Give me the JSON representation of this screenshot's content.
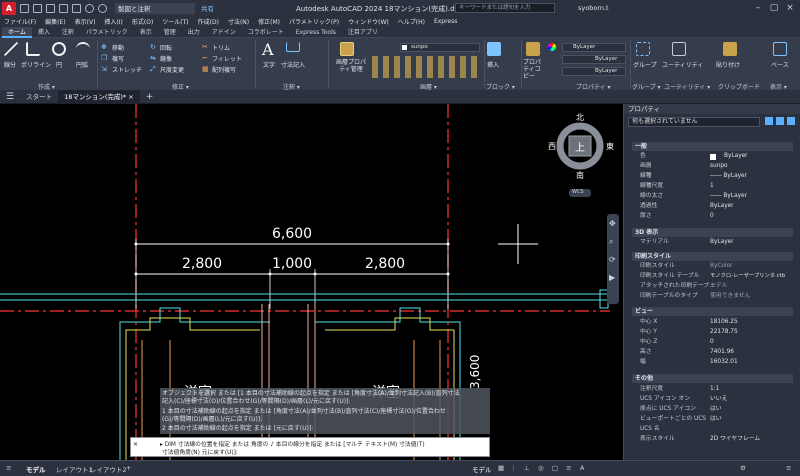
{
  "titlebar": {
    "app_letter": "A",
    "workspace": "製図と注釈",
    "share": "共有",
    "title": "Autodesk AutoCAD 2024   18マンション(完成).dwg",
    "search_placeholder": "キーワードまたは語句を入力",
    "user": "syoborn.t"
  },
  "menu": [
    "ファイル(F)",
    "編集(E)",
    "表示(V)",
    "挿入(I)",
    "形式(O)",
    "ツール(T)",
    "作成(D)",
    "寸法(N)",
    "修正(M)",
    "パラメトリック(P)",
    "ウィンドウ(W)",
    "ヘルプ(H)",
    "Express"
  ],
  "ribbon_tabs": [
    "ホーム",
    "挿入",
    "注釈",
    "パラメトリック",
    "表示",
    "管理",
    "出力",
    "アドイン",
    "コラボレート",
    "Express Tools",
    "注目アプリ"
  ],
  "ribbon": {
    "draw": [
      "線分",
      "ポリライン",
      "円",
      "円弧"
    ],
    "modify": [
      "移動",
      "回転",
      "トリム",
      "複写",
      "鏡像",
      "フィレット",
      "ストレッチ",
      "尺度変更",
      "配列複写"
    ],
    "annotation": [
      "文字",
      "寸法記入"
    ],
    "layers": [
      "画層プロパティ管理"
    ],
    "layer_current": "sunpo",
    "block": [
      "挿入"
    ],
    "properties_btn": [
      "プロパティコピー"
    ],
    "bylayer": [
      "ByLayer",
      "ByLayer",
      "ByLayer"
    ],
    "groups": [
      "グループ"
    ],
    "utilities": [
      "ユーティリティ"
    ],
    "clipboard": [
      "貼り付け"
    ],
    "base": [
      "ベース"
    ],
    "group_labels": [
      "作成 ▾",
      "修正 ▾",
      "注釈 ▾",
      "画層 ▾",
      "ブロック ▾",
      "プロパティ ▾",
      "グループ ▾",
      "ユーティリティ ▾",
      "クリップボード",
      "表示 ▾"
    ]
  },
  "file_tabs": [
    "スタート",
    "18マンション(完成)*"
  ],
  "viewcube": {
    "n": "北",
    "s": "南",
    "e": "東",
    "w": "西",
    "face": "上",
    "wcs": "WCS"
  },
  "drawing": {
    "dims": [
      "6,600",
      "2,800",
      "1,000",
      "2,800"
    ],
    "room_labels": [
      "洋室",
      "洋室"
    ],
    "vertical_dim": "3,600"
  },
  "command": {
    "history": [
      "オブジェクトを選択 または [1 本目の寸法補助線の起点を指定 または [角度寸法(A)/並列寸法記入(B)/直列寸法",
      "記入(C)/座標寸法(O)/位置合わせ(G)/等間隔(D)/画層(L)/元に戻す(U)]:",
      "1 本目の寸法補助線の起点を指定 または [角度寸法(A)/並列寸法(B)/直列寸法(C)/座標寸法(O)/位置合わせ",
      "(G)/等間隔(D)/画層(L)/元に戻す(U)]:",
      "2 本目の寸法補助線の起点を指定 または [元に戻す(U)]:"
    ],
    "prompt1": "▸ DIM 寸法線の位置を指定 または 角度の ♪ 本目の線分を指定 または [マルチ テキスト(M) 寸法値(T)",
    "prompt2": "寸法値角度(N) 元に戻す(U)]:"
  },
  "properties": {
    "title": "プロパティ",
    "selection": "何も選択されていません",
    "sections": [
      {
        "name": "一般",
        "rows": [
          [
            "色",
            "ByLayer"
          ],
          [
            "画層",
            "sunpo"
          ],
          [
            "線種",
            "―― ByLayer"
          ],
          [
            "線種尺度",
            "1"
          ],
          [
            "線の太さ",
            "―― ByLayer"
          ],
          [
            "透過性",
            "ByLayer"
          ],
          [
            "厚さ",
            "0"
          ]
        ]
      },
      {
        "name": "3D 表示",
        "rows": [
          [
            "マテリアル",
            "ByLayer"
          ]
        ]
      },
      {
        "name": "印刷スタイル",
        "rows": [
          [
            "印刷スタイル",
            "ByColor"
          ],
          [
            "印刷スタイル テーブル",
            "モノクロ-レーザープリンタ.ctb"
          ],
          [
            "アタッチされた印刷テーブ...",
            "モデル"
          ],
          [
            "印刷テーブルのタイプ",
            "使用できません"
          ]
        ]
      },
      {
        "name": "ビュー",
        "rows": [
          [
            "中心 X",
            "18106.25"
          ],
          [
            "中心 Y",
            "22178.75"
          ],
          [
            "中心 Z",
            "0"
          ],
          [
            "高さ",
            "7401.96"
          ],
          [
            "幅",
            "16032.01"
          ]
        ]
      },
      {
        "name": "その他",
        "rows": [
          [
            "注釈尺度",
            "1:1"
          ],
          [
            "UCS アイコン オン",
            "いいえ"
          ],
          [
            "原点に UCS アイコン",
            "はい"
          ],
          [
            "ビューポートごとの UCS",
            "はい"
          ],
          [
            "UCS 名",
            ""
          ],
          [
            "表示スタイル",
            "2D ワイヤフレーム"
          ]
        ]
      }
    ]
  },
  "layout_tabs": [
    "モデル",
    "レイアウト1",
    "レイアウト2"
  ],
  "status_model": "モデル",
  "colors": {
    "accent": "#5ab0ff",
    "wall_cyan": "#55e0e8",
    "wall_yellow": "#e8e05a",
    "center_red": "#ff3333",
    "dim_white": "#ffffff",
    "brand": "#d21f2c"
  }
}
